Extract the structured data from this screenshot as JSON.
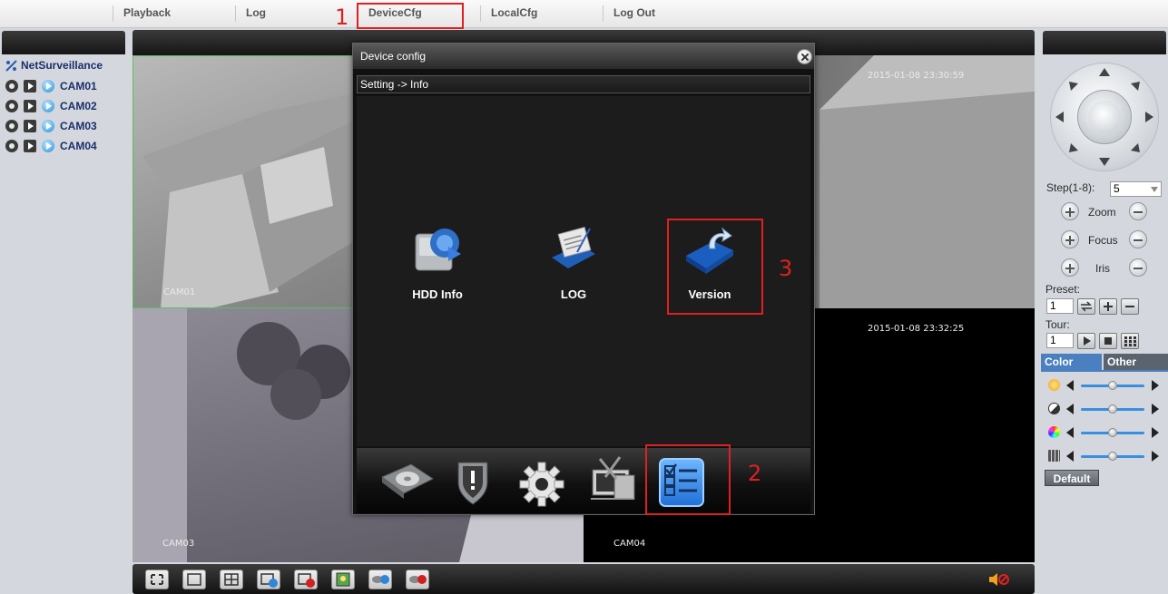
{
  "menu": {
    "items": [
      "Playback",
      "Log",
      "DeviceCfg",
      "LocalCfg",
      "Log Out"
    ]
  },
  "annotations": [
    "1",
    "2",
    "3"
  ],
  "tree": {
    "root": "NetSurveillance",
    "cameras": [
      "CAM01",
      "CAM02",
      "CAM03",
      "CAM04"
    ]
  },
  "video": {
    "tiles": [
      {
        "label": "CAM01",
        "timestamp": ""
      },
      {
        "label": "",
        "timestamp": "2015-01-08 23:30:59"
      },
      {
        "label": "CAM03",
        "timestamp": ""
      },
      {
        "label": "CAM04",
        "timestamp": "2015-01-08 23:32:25"
      }
    ]
  },
  "dialog": {
    "title": "Device config",
    "breadcrumb": "Setting -> Info",
    "items": [
      {
        "label": "HDD Info",
        "icon": "hdd-info-icon"
      },
      {
        "label": "LOG",
        "icon": "log-icon"
      },
      {
        "label": "Version",
        "icon": "version-icon"
      }
    ],
    "dock": [
      "record-config-icon",
      "alarm-config-icon",
      "system-setting-icon",
      "management-tools-icon",
      "system-info-icon"
    ]
  },
  "ptz": {
    "step_label": "Step(1-8):",
    "step_value": "5",
    "zoom": "Zoom",
    "focus": "Focus",
    "iris": "Iris",
    "preset_label": "Preset:",
    "preset_value": "1",
    "tour_label": "Tour:",
    "tour_value": "1"
  },
  "image_tabs": [
    "Color",
    "Other"
  ],
  "default_label": "Default",
  "colors": {
    "accent": "#2f86d8",
    "annotation": "#e02020"
  }
}
